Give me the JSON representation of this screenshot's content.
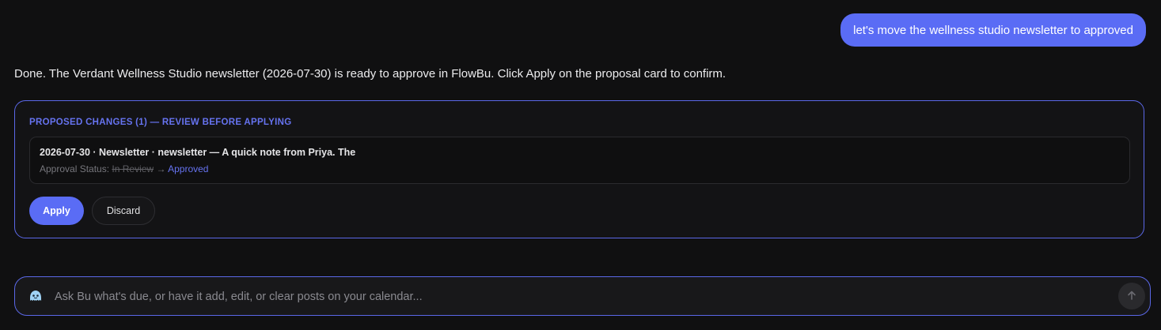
{
  "conversation": {
    "user_message": "let's move the wellness studio newsletter to approved",
    "assistant_message": "Done. The Verdant Wellness Studio newsletter (2026-07-30) is ready to approve in FlowBu. Click Apply on the proposal card to confirm."
  },
  "proposal": {
    "heading": "PROPOSED CHANGES (1) — REVIEW BEFORE APPLYING",
    "changes": [
      {
        "title": "2026-07-30 · Newsletter · newsletter — A quick note from Priya. The",
        "field_label": "Approval Status:",
        "old_value": "In Review",
        "arrow": "→",
        "new_value": "Approved"
      }
    ],
    "apply_label": "Apply",
    "discard_label": "Discard"
  },
  "composer": {
    "placeholder": "Ask Bu what's due, or have it add, edit, or clear posts on your calendar...",
    "value": "",
    "assistant_icon": "bot-face-icon",
    "send_icon": "arrow-up-icon"
  },
  "colors": {
    "accent": "#5a6cf5",
    "background": "#101011",
    "card_border": "#5b68e8",
    "accent_text": "#6673f0"
  }
}
